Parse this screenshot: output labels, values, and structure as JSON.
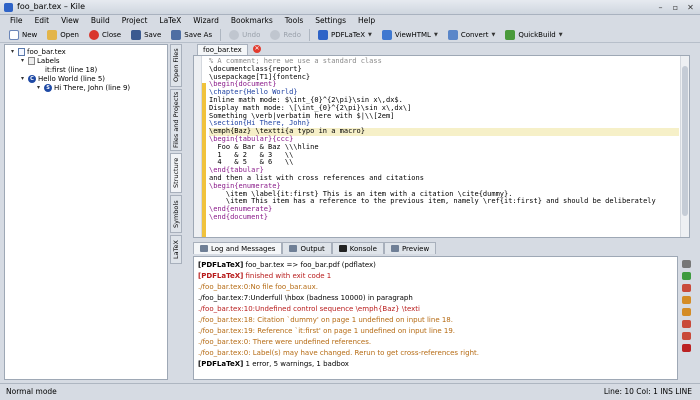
{
  "window": {
    "title": "foo_bar.tex – Kile"
  },
  "menu": [
    "File",
    "Edit",
    "View",
    "Build",
    "Project",
    "LaTeX",
    "Wizard",
    "Bookmarks",
    "Tools",
    "Settings",
    "Help"
  ],
  "toolbar": {
    "new": "New",
    "open": "Open",
    "close": "Close",
    "save": "Save",
    "save_as": "Save As",
    "undo": "Undo",
    "redo": "Redo",
    "pdflatex": "PDFLaTeX",
    "viewhtml": "ViewHTML",
    "convert": "Convert",
    "quickbuild": "QuickBuild"
  },
  "structure": {
    "root": "foo_bar.tex",
    "labels": "Labels",
    "label_item": "it:first (line 18)",
    "chapter": "Hello World (line 5)",
    "section": "Hi There, John (line 9)"
  },
  "side_tabs": [
    "Open Files",
    "Files and Projects",
    "Structure",
    "Symbols",
    "LaTeX"
  ],
  "editor": {
    "tab_name": "foo_bar.tex",
    "lines": [
      "% A comment; here we use a standard class",
      "\\documentclass{report}",
      "\\usepackage[T1]{fontenc}",
      "\\begin{document}",
      "\\chapter{Hello World}",
      "Inline math mode: $\\int_{0}^{2\\pi}\\sin x\\,dx$.",
      "Display math mode: \\[\\int_{0}^{2\\pi}\\sin x\\,dx\\]",
      "Something \\verb|verbatim here with $|\\\\[2em]",
      "\\section{Hi There, John}",
      "\\emph{Baz} \\textti{a typo in a macro}",
      "\\begin{tabular}{ccc}",
      "  Foo & Bar & Baz \\\\\\hline",
      "  1   & 2   & 3   \\\\",
      "  4   & 5   & 6   \\\\",
      "\\end{tabular}",
      "and then a list with cross references and citations",
      "\\begin{enumerate}",
      "    \\item \\label{it:first} This is an item with a citation \\cite{dummy}.",
      "    \\item This item has a reference to the previous item, namely \\ref{it:first} and should be deliberately",
      "\\end{enumerate}",
      "\\end{document}"
    ]
  },
  "bottom_tabs": [
    "Log and Messages",
    "Output",
    "Konsole",
    "Preview"
  ],
  "log": [
    {
      "tag": "[PDFLaTeX]",
      "text": " foo_bar.tex => foo_bar.pdf (pdflatex)",
      "kind": "info"
    },
    {
      "tag": "[PDFLaTeX]",
      "text": " finished with exit code 1",
      "kind": "error"
    },
    {
      "tag": "",
      "text": "./foo_bar.tex:0:No file foo_bar.aux.",
      "kind": "warn"
    },
    {
      "tag": "",
      "text": "./foo_bar.tex:7:Underfull \\hbox (badness 10000) in paragraph",
      "kind": "info"
    },
    {
      "tag": "",
      "text": "./foo_bar.tex:10:Undefined control sequence \\emph{Baz} \\texti",
      "kind": "error"
    },
    {
      "tag": "",
      "text": "./foo_bar.tex:18: Citation `dummy' on page 1 undefined on input line 18.",
      "kind": "warn"
    },
    {
      "tag": "",
      "text": "./foo_bar.tex:19: Reference `it:first' on page 1 undefined on input line 19.",
      "kind": "warn"
    },
    {
      "tag": "",
      "text": "./foo_bar.tex:0: There were undefined references.",
      "kind": "warn"
    },
    {
      "tag": "",
      "text": "./foo_bar.tex:0: Label(s) may have changed. Rerun to get cross-references right.",
      "kind": "warn"
    },
    {
      "tag": "[PDFLaTeX]",
      "text": " 1 error, 5 warnings, 1 badbox",
      "kind": "info"
    }
  ],
  "status": {
    "mode": "Normal mode",
    "position": "Line: 10 Col: 1  INS  LINE"
  },
  "colors": {
    "accent": "#2e63c7",
    "error": "#b81b1b",
    "warning": "#b56a12"
  }
}
